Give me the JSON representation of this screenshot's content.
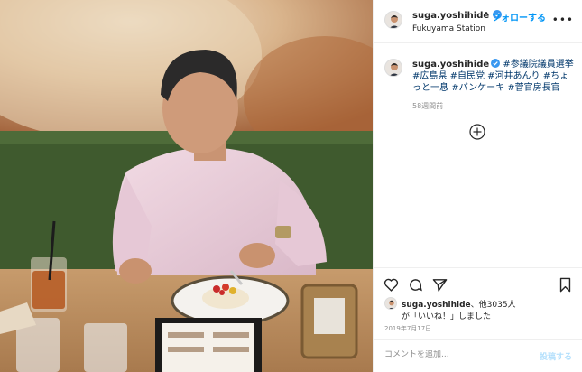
{
  "post": {
    "username": "suga.yoshihide",
    "follow_label": "フォローする",
    "location": "Fukuyama Station",
    "caption_tags": [
      "#参議院議員選挙",
      "#広島県",
      "#自民党",
      "#河井あんり",
      "#ちょっと一息",
      "#パンケーキ",
      "#菅官房長官"
    ],
    "time_ago": "58週間前",
    "likes_line1_user": "suga.yoshihide",
    "likes_line1_rest": "、他3035人",
    "likes_line2": "が「いいね！」しました",
    "date": "2019年7月17日",
    "comment_placeholder": "コメントを追加...",
    "post_label": "投稿する"
  },
  "icons": [
    "verified-badge-icon",
    "more-options-icon",
    "add-circle-icon",
    "heart-icon",
    "comment-icon",
    "share-icon",
    "bookmark-icon"
  ],
  "colors": {
    "link_blue": "#0095f6",
    "hashtag": "#00376b",
    "muted": "#8e8e8e",
    "border": "#efefef"
  }
}
